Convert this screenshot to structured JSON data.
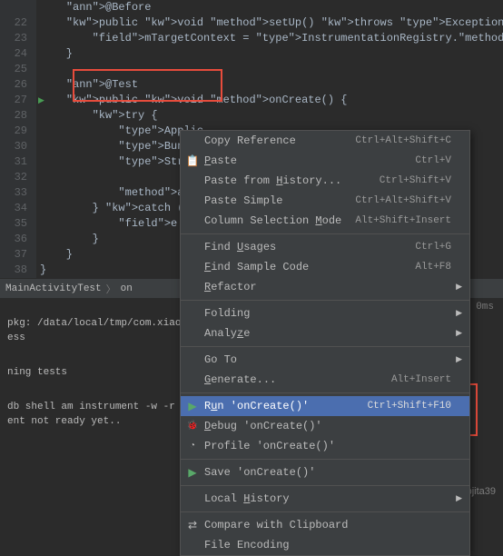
{
  "code": {
    "lines": [
      {
        "num": "",
        "content": "    @Before"
      },
      {
        "num": "22",
        "content": "    public void setUp() throws Exception {"
      },
      {
        "num": "23",
        "content": "        mTargetContext = InstrumentationRegistry.getTargetContext();"
      },
      {
        "num": "24",
        "content": "    }"
      },
      {
        "num": "25",
        "content": ""
      },
      {
        "num": "26",
        "content": "    @Test"
      },
      {
        "num": "27",
        "content": "    public void onCreate() {",
        "marker": true
      },
      {
        "num": "28",
        "content": "        try {"
      },
      {
        "num": "29",
        "content": "            Applic                                                etPackageMan"
      },
      {
        "num": "30",
        "content": "            Bundle"
      },
      {
        "num": "31",
        "content": "            String                                                g.TEST\");"
      },
      {
        "num": "32",
        "content": ""
      },
      {
        "num": "33",
        "content": "            assertE"
      },
      {
        "num": "34",
        "content": "        } catch (Pa"
      },
      {
        "num": "35",
        "content": "            e.print"
      },
      {
        "num": "36",
        "content": "        }"
      },
      {
        "num": "37",
        "content": "    }"
      },
      {
        "num": "38",
        "content": "}"
      }
    ]
  },
  "breadcrumbs": {
    "file": "MainActivityTest",
    "method": "on"
  },
  "console": {
    "status_right": "ssed – 0ms",
    "line1": "pkg: /data/local/tmp/com.xiaoying",
    "line2": "ess",
    "line3": "",
    "line4": "ning tests",
    "line5": "",
    "line6": "db shell am instrument -w -r   -e d",
    "line7": "ent not ready yet.."
  },
  "menu": {
    "items": [
      {
        "label": "Copy Reference",
        "shortcut": "Ctrl+Alt+Shift+C"
      },
      {
        "label": "Paste",
        "shortcut": "Ctrl+V",
        "icon": "paste",
        "mnemonic": "P"
      },
      {
        "label": "Paste from History...",
        "shortcut": "Ctrl+Shift+V",
        "mnemonic": "H"
      },
      {
        "label": "Paste Simple",
        "shortcut": "Ctrl+Alt+Shift+V"
      },
      {
        "label": "Column Selection Mode",
        "shortcut": "Alt+Shift+Insert",
        "mnemonic": "M"
      },
      {
        "sep": true
      },
      {
        "label": "Find Usages",
        "shortcut": "Ctrl+G",
        "mnemonic": "U"
      },
      {
        "label": "Find Sample Code",
        "shortcut": "Alt+F8",
        "mnemonic": "F"
      },
      {
        "label": "Refactor",
        "arrow": true,
        "mnemonic": "R"
      },
      {
        "sep": true
      },
      {
        "label": "Folding",
        "arrow": true
      },
      {
        "label": "Analyze",
        "arrow": true,
        "mnemonic": "z"
      },
      {
        "sep": true
      },
      {
        "label": "Go To",
        "arrow": true
      },
      {
        "label": "Generate...",
        "shortcut": "Alt+Insert",
        "mnemonic": "G"
      },
      {
        "sep": true
      },
      {
        "label": "Run 'onCreate()'",
        "shortcut": "Ctrl+Shift+F10",
        "icon": "run",
        "mnemonic": "u",
        "selected": true
      },
      {
        "label": "Debug 'onCreate()'",
        "icon": "debug",
        "mnemonic": "D"
      },
      {
        "label": "Profile 'onCreate()'",
        "icon": "profile"
      },
      {
        "sep": true
      },
      {
        "label": "Save 'onCreate()'",
        "icon": "save"
      },
      {
        "sep": true
      },
      {
        "label": "Local History",
        "arrow": true,
        "mnemonic": "H"
      },
      {
        "sep": true
      },
      {
        "label": "Compare with Clipboard",
        "icon": "compare"
      },
      {
        "label": "File Encoding"
      }
    ]
  },
  "watermark": "https://blog.csdn.net/lixpjita39"
}
